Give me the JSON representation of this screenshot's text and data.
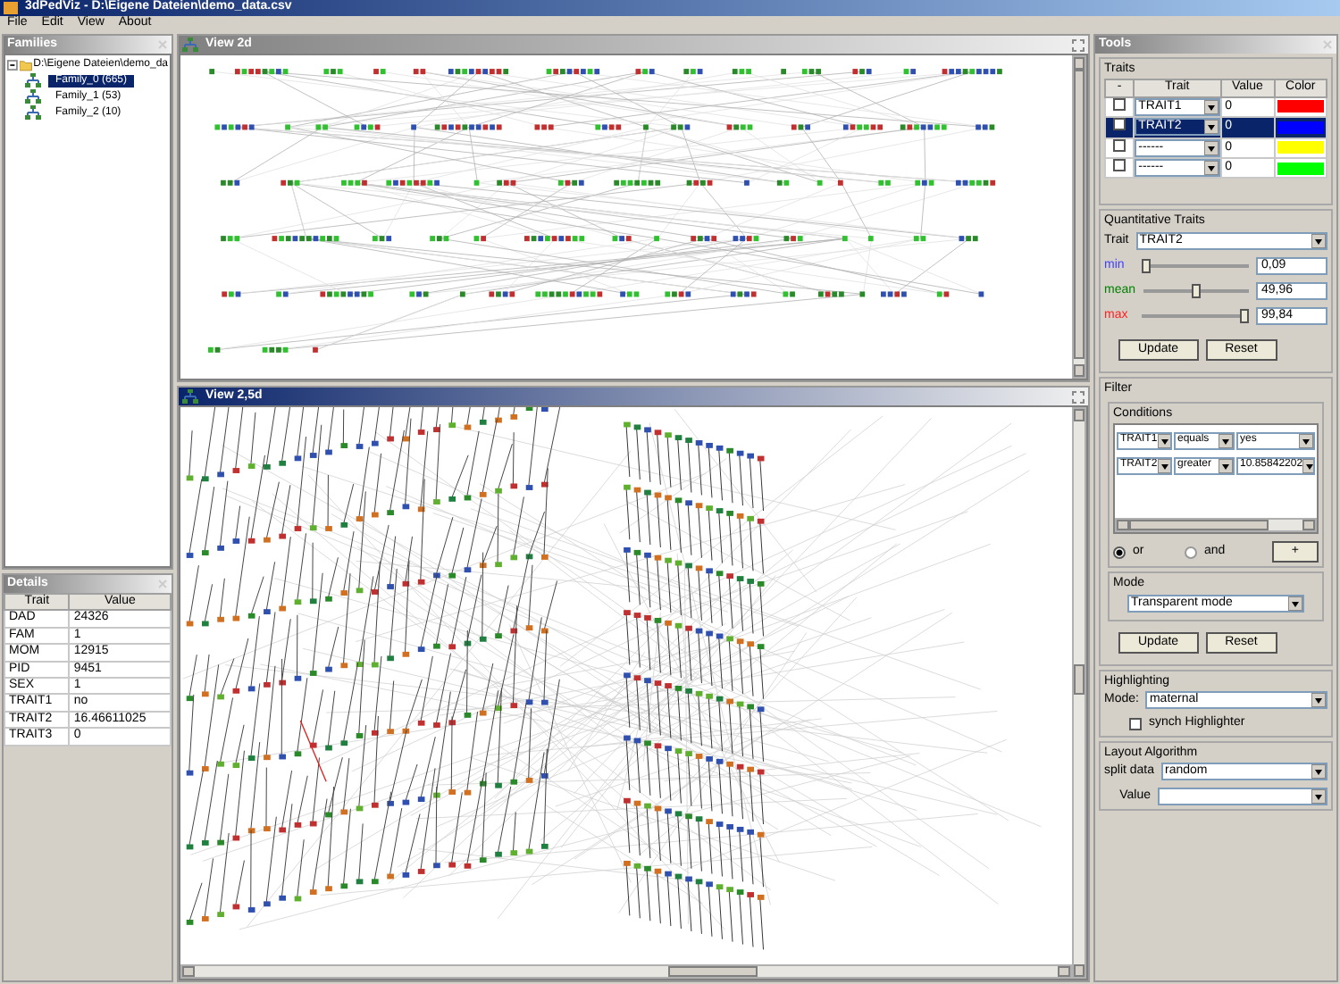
{
  "window": {
    "title": "3dPedViz - D:\\Eigene Dateien\\demo_data.csv"
  },
  "menu": [
    "File",
    "Edit",
    "View",
    "About"
  ],
  "families": {
    "title": "Families",
    "root": {
      "label": "D:\\Eigene Dateien\\demo_da",
      "expanded": true,
      "children": [
        {
          "label": "Family_0 (665)",
          "selected": true
        },
        {
          "label": "Family_1 (53)",
          "selected": false
        },
        {
          "label": "Family_2 (10)",
          "selected": false
        }
      ]
    }
  },
  "details": {
    "title": "Details",
    "columns": [
      "Trait",
      "Value"
    ],
    "rows": [
      [
        "DAD",
        "24326"
      ],
      [
        "FAM",
        "1"
      ],
      [
        "MOM",
        "12915"
      ],
      [
        "PID",
        "9451"
      ],
      [
        "SEX",
        "1"
      ],
      [
        "TRAIT1",
        "no"
      ],
      [
        "TRAIT2",
        "16.46611025"
      ],
      [
        "TRAIT3",
        "0"
      ]
    ]
  },
  "views": [
    {
      "title": "View 2d",
      "kind": "flat",
      "active": false
    },
    {
      "title": "View 2,5d",
      "kind": "perspective",
      "active": true
    }
  ],
  "tools": {
    "title": "Tools",
    "traits": {
      "title": "Traits",
      "columns": [
        "-",
        "Trait",
        "Value",
        "Color"
      ],
      "rows": [
        {
          "checked": false,
          "trait": "TRAIT1",
          "value": "0",
          "color": "#ff0000",
          "selected": false
        },
        {
          "checked": false,
          "trait": "TRAIT2",
          "value": "0",
          "color": "#0000ff",
          "selected": true
        },
        {
          "checked": false,
          "trait": "------",
          "value": "0",
          "color": "#ffff00",
          "selected": false
        },
        {
          "checked": false,
          "trait": "------",
          "value": "0",
          "color": "#00ff00",
          "selected": false
        }
      ]
    },
    "quantitative": {
      "title": "Quantitative Traits",
      "trait_label": "Trait",
      "trait": "TRAIT2",
      "sliders": [
        {
          "label": "min",
          "color": "#4040ff",
          "level": 0.0,
          "value": "0,09"
        },
        {
          "label": "mean",
          "color": "#008000",
          "level": 0.5,
          "value": "49,96"
        },
        {
          "label": "max",
          "color": "#ff2020",
          "level": 1.0,
          "value": "99,84"
        }
      ],
      "buttons": [
        "Update",
        "Reset"
      ]
    },
    "filter": {
      "title": "Filter",
      "conditions_title": "Conditions",
      "conditions": [
        [
          "TRAIT1",
          "equals",
          "yes"
        ],
        [
          "TRAIT2",
          "greater",
          "10.85842202"
        ]
      ],
      "combine": [
        {
          "label": "or",
          "selected": true
        },
        {
          "label": "and",
          "selected": false
        }
      ],
      "add": "+",
      "mode_title": "Mode",
      "mode": "Transparent mode",
      "buttons": [
        "Update",
        "Reset"
      ]
    },
    "highlighting": {
      "title": "Highlighting",
      "mode_label": "Mode:",
      "mode": "maternal",
      "synch": {
        "label": "synch Highlighter",
        "checked": false
      }
    },
    "layout": {
      "title": "Layout Algorithm",
      "split_label": "split data",
      "split": "random",
      "value_label": "Value"
    }
  }
}
